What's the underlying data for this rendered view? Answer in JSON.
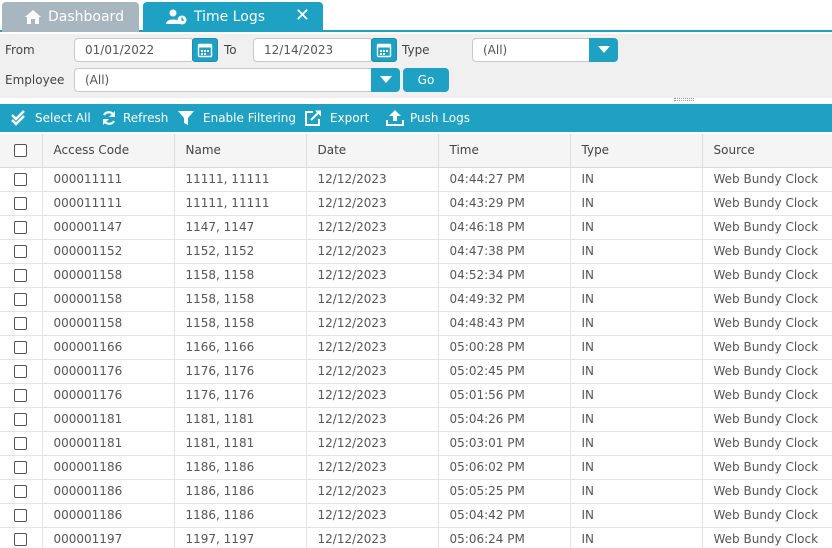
{
  "tabs": [
    {
      "label": "Dashboard",
      "icon": "home-icon",
      "active": false
    },
    {
      "label": "Time Logs",
      "icon": "user-clock-icon",
      "active": true
    }
  ],
  "filters": {
    "from_label": "From",
    "from_value": "01/01/2022",
    "to_label": "To",
    "to_value": "12/14/2023",
    "type_label": "Type",
    "type_value": "(All)",
    "employee_label": "Employee",
    "employee_value": "(All)",
    "go_label": "Go"
  },
  "toolbar": {
    "select_all": "Select All",
    "refresh": "Refresh",
    "enable_filtering": "Enable Filtering",
    "export": "Export",
    "push_logs": "Push Logs"
  },
  "grid": {
    "columns": [
      "Access Code",
      "Name",
      "Date",
      "Time",
      "Type",
      "Source"
    ],
    "rows": [
      {
        "code": "000011111",
        "name": "11111, 11111",
        "date": "12/12/2023",
        "time": "04:44:27 PM",
        "type": "IN",
        "source": "Web Bundy Clock"
      },
      {
        "code": "000011111",
        "name": "11111, 11111",
        "date": "12/12/2023",
        "time": "04:43:29 PM",
        "type": "IN",
        "source": "Web Bundy Clock"
      },
      {
        "code": "000001147",
        "name": "1147, 1147",
        "date": "12/12/2023",
        "time": "04:46:18 PM",
        "type": "IN",
        "source": "Web Bundy Clock"
      },
      {
        "code": "000001152",
        "name": "1152, 1152",
        "date": "12/12/2023",
        "time": "04:47:38 PM",
        "type": "IN",
        "source": "Web Bundy Clock"
      },
      {
        "code": "000001158",
        "name": "1158, 1158",
        "date": "12/12/2023",
        "time": "04:52:34 PM",
        "type": "IN",
        "source": "Web Bundy Clock"
      },
      {
        "code": "000001158",
        "name": "1158, 1158",
        "date": "12/12/2023",
        "time": "04:49:32 PM",
        "type": "IN",
        "source": "Web Bundy Clock"
      },
      {
        "code": "000001158",
        "name": "1158, 1158",
        "date": "12/12/2023",
        "time": "04:48:43 PM",
        "type": "IN",
        "source": "Web Bundy Clock"
      },
      {
        "code": "000001166",
        "name": "1166, 1166",
        "date": "12/12/2023",
        "time": "05:00:28 PM",
        "type": "IN",
        "source": "Web Bundy Clock"
      },
      {
        "code": "000001176",
        "name": "1176, 1176",
        "date": "12/12/2023",
        "time": "05:02:45 PM",
        "type": "IN",
        "source": "Web Bundy Clock"
      },
      {
        "code": "000001176",
        "name": "1176, 1176",
        "date": "12/12/2023",
        "time": "05:01:56 PM",
        "type": "IN",
        "source": "Web Bundy Clock"
      },
      {
        "code": "000001181",
        "name": "1181, 1181",
        "date": "12/12/2023",
        "time": "05:04:26 PM",
        "type": "IN",
        "source": "Web Bundy Clock"
      },
      {
        "code": "000001181",
        "name": "1181, 1181",
        "date": "12/12/2023",
        "time": "05:03:01 PM",
        "type": "IN",
        "source": "Web Bundy Clock"
      },
      {
        "code": "000001186",
        "name": "1186, 1186",
        "date": "12/12/2023",
        "time": "05:06:02 PM",
        "type": "IN",
        "source": "Web Bundy Clock"
      },
      {
        "code": "000001186",
        "name": "1186, 1186",
        "date": "12/12/2023",
        "time": "05:05:25 PM",
        "type": "IN",
        "source": "Web Bundy Clock"
      },
      {
        "code": "000001186",
        "name": "1186, 1186",
        "date": "12/12/2023",
        "time": "05:04:42 PM",
        "type": "IN",
        "source": "Web Bundy Clock"
      },
      {
        "code": "000001197",
        "name": "1197, 1197",
        "date": "12/12/2023",
        "time": "05:06:24 PM",
        "type": "IN",
        "source": "Web Bundy Clock"
      }
    ]
  },
  "colors": {
    "accent": "#1ea1c2",
    "inactive_tab": "#a8b7bf",
    "panel": "#f0f0f0"
  }
}
